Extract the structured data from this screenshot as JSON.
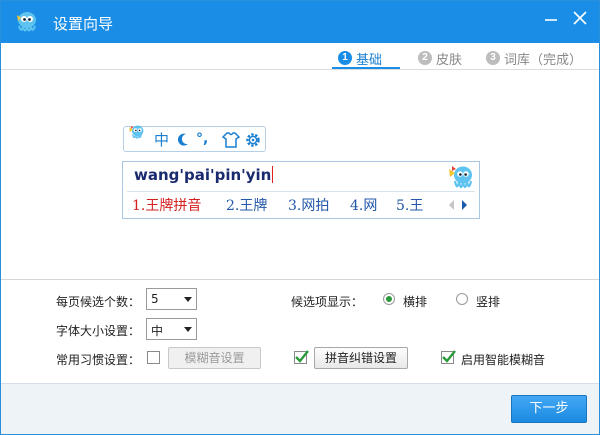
{
  "window": {
    "title": "设置向导"
  },
  "steps": [
    {
      "num": "1",
      "label": "基础"
    },
    {
      "num": "2",
      "label": "皮肤"
    },
    {
      "num": "3",
      "label": "词库（完成）"
    }
  ],
  "preview": {
    "toolbar": {
      "mode": "中",
      "punct": "°,"
    },
    "input": "wang'pai'pin'yin",
    "candidates": [
      "1.王牌拼音",
      "2.王牌",
      "3.网拍",
      "4.网",
      "5.王"
    ]
  },
  "settings": {
    "per_page_label": "每页候选个数：",
    "per_page_value": "5",
    "font_size_label": "字体大小设置：",
    "font_size_value": "中",
    "habit_label": "常用习惯设置：",
    "fuzzy_button": "模糊音设置",
    "correction_button": "拼音纠错设置",
    "smart_fuzzy_label": "启用智能模糊音",
    "display_label": "候选项显示：",
    "horizontal_label": "横排",
    "vertical_label": "竖排"
  },
  "footer": {
    "next_label": "下一步"
  },
  "colors": {
    "accent": "#1a8ee6",
    "highlight_candidate": "#d41f1f",
    "candidate": "#2257a8"
  },
  "icons": [
    "app-logo-icon",
    "minimize-icon",
    "close-icon",
    "moon-icon",
    "skin-icon",
    "gear-icon",
    "prev-page-icon",
    "next-page-icon",
    "check-icon"
  ]
}
